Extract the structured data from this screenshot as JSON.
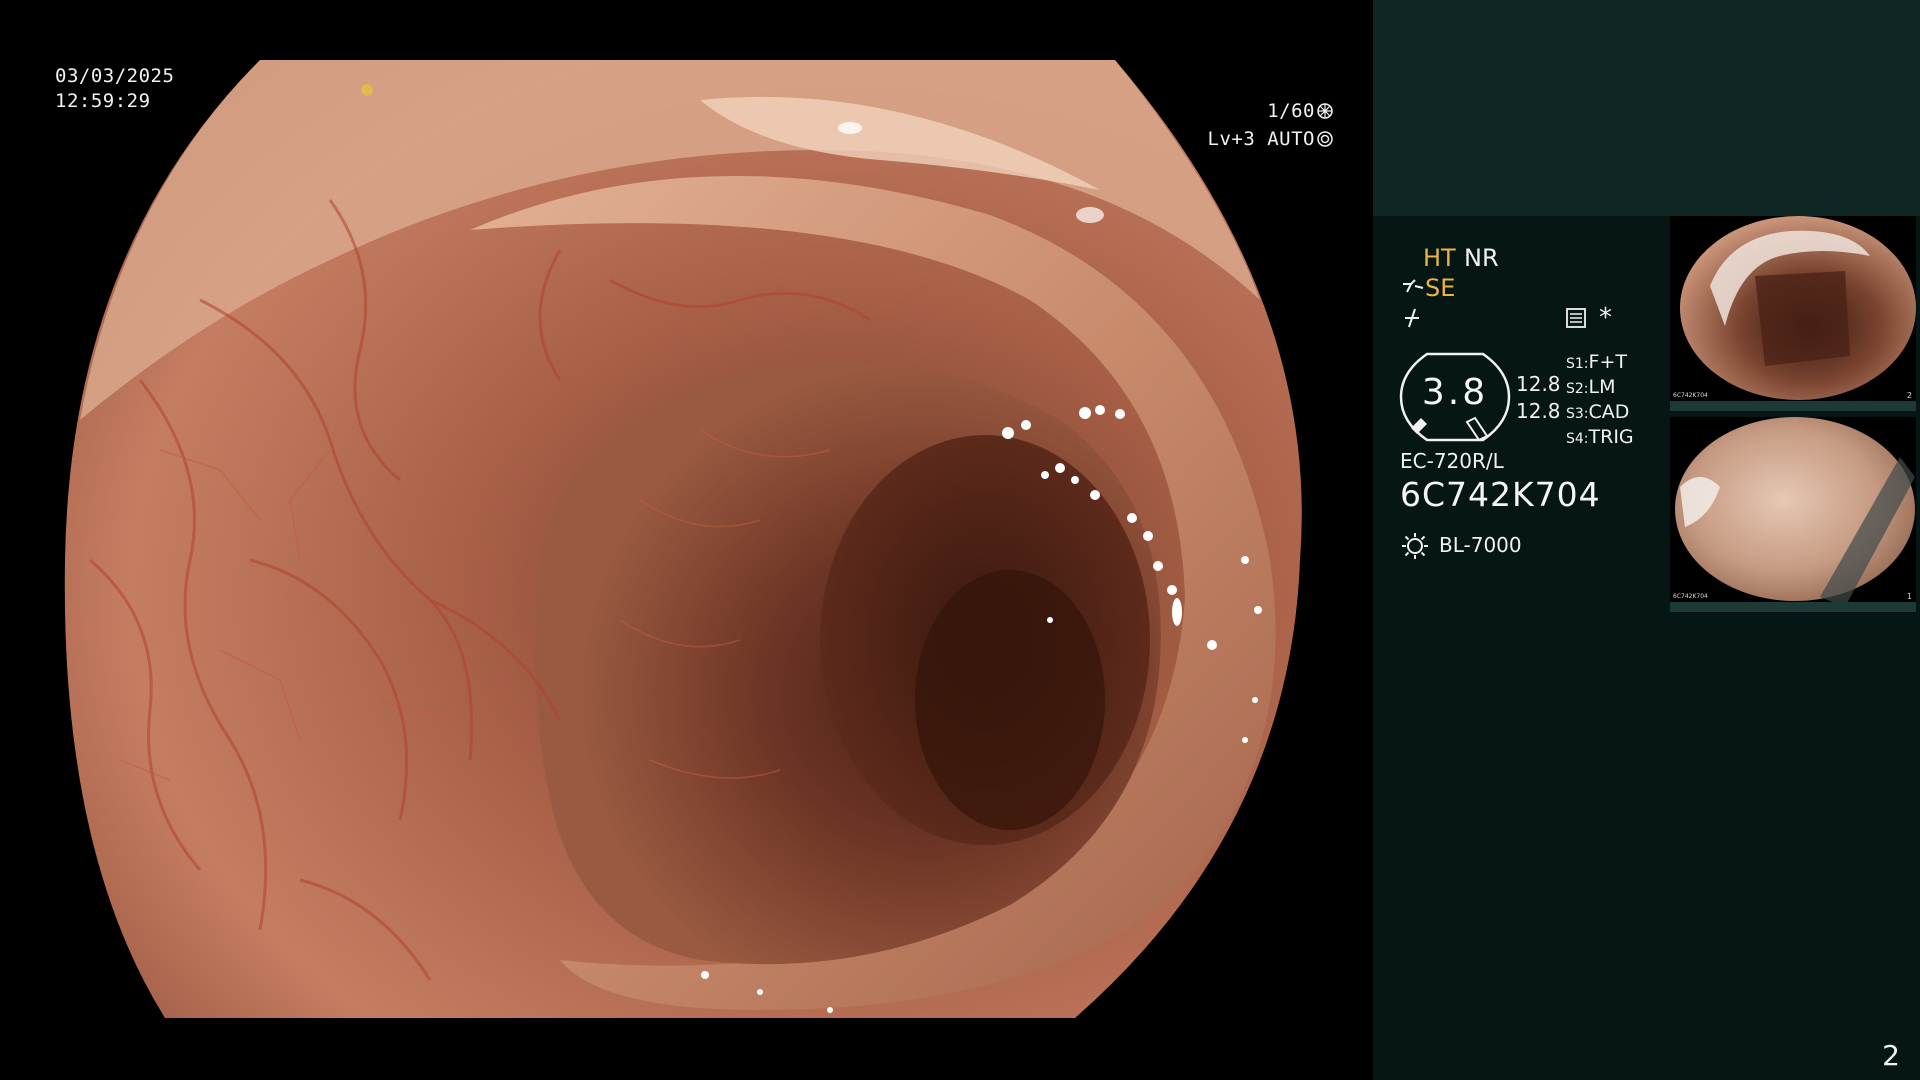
{
  "overlay": {
    "date": "03/03/2025",
    "time": "12:59:29",
    "shutter": "1/60",
    "level": "Lv+3 AUTO"
  },
  "panel": {
    "flag_ht": "HT",
    "flag_nr": "NR",
    "flag_se": "SE",
    "star": "*",
    "gauge_value": "3.8",
    "angle_1": "12.8",
    "angle_2": "12.8",
    "switches": [
      {
        "key": "S1:",
        "value": "F+T"
      },
      {
        "key": "S2:",
        "value": "LM"
      },
      {
        "key": "S3:",
        "value": "CAD"
      },
      {
        "key": "S4:",
        "value": "TRIG"
      }
    ],
    "scope_model": "EC-720R/L",
    "scope_serial": "6C742K704",
    "light_source": "BL-7000",
    "page_number": "2"
  },
  "thumbnails": [
    {
      "serial": "6C742K704",
      "number": "2"
    },
    {
      "serial": "6C742K704",
      "number": "1"
    }
  ],
  "colors": {
    "panel_bg": "#061614",
    "panel_top_bg": "#0e2523",
    "accent_orange": "#e9b444",
    "text": "#f1f1f1"
  },
  "icons": [
    "shutter-icon",
    "auto-iris-icon",
    "structure-enhance-icon",
    "freeze-icon",
    "memo-icon",
    "light-source-icon"
  ]
}
